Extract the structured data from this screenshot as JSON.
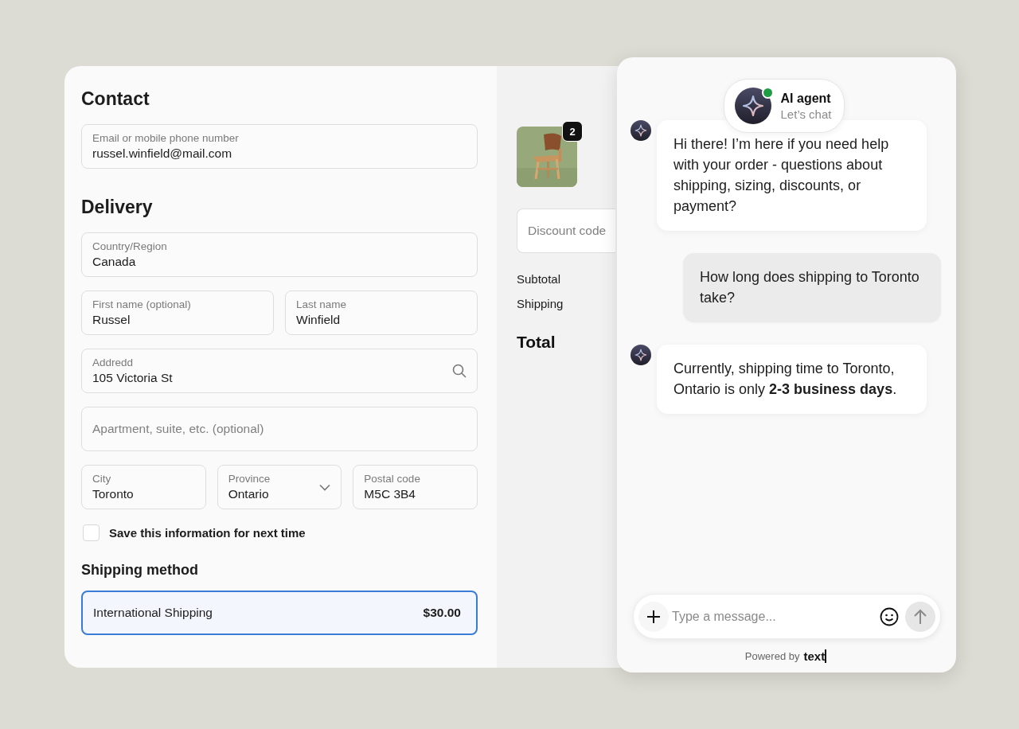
{
  "contact": {
    "heading": "Contact",
    "field": {
      "kind": "text",
      "label": "Email or mobile phone number",
      "value": "russel.winfield@mail.com"
    }
  },
  "delivery": {
    "heading": "Delivery",
    "rows": [
      [
        {
          "kind": "text",
          "label": "Country/Region",
          "value": "Canada"
        }
      ],
      [
        {
          "kind": "text",
          "label": "First name (optional)",
          "value": "Russel"
        },
        {
          "kind": "text",
          "label": "Last name",
          "value": "Winfield"
        }
      ],
      [
        {
          "kind": "search",
          "label": "Addredd",
          "value": "105 Victoria St"
        }
      ],
      [
        {
          "kind": "text",
          "placeholder": "Apartment, suite, etc. (optional)"
        }
      ],
      [
        {
          "kind": "text",
          "label": "City",
          "value": "Toronto"
        },
        {
          "kind": "select",
          "label": "Province",
          "value": "Ontario"
        },
        {
          "kind": "text",
          "label": "Postal code",
          "value": "M5C 3B4"
        }
      ]
    ],
    "save": {
      "label": "Save this information for next time",
      "checked": false
    }
  },
  "shipping_method": {
    "heading": "Shipping method",
    "options": [
      {
        "label": "International Shipping",
        "price": "$30.00",
        "selected": true
      }
    ]
  },
  "summary": {
    "item": {
      "kind": "picture",
      "quantity": "2"
    },
    "discount": {
      "placeholder": "Discount code"
    },
    "lines": [
      {
        "label": "Subtotal"
      },
      {
        "label": "Shipping"
      }
    ],
    "total": {
      "label": "Total"
    }
  },
  "chat": {
    "agent": {
      "name": "AI agent",
      "status": "Let’s chat",
      "online": true
    },
    "messages": [
      {
        "kind": "agent",
        "text": "Hi there! I’m here if you need help with your order - questions about shipping, sizing, discounts, or payment?"
      },
      {
        "kind": "user",
        "text": "How long does shipping to Toronto take?"
      },
      {
        "kind": "agent",
        "text": "Currently, shipping time to Toronto, Ontario is only **2-3 business days**."
      }
    ],
    "composer": {
      "placeholder": "Type a message..."
    },
    "footer": {
      "prefix": "Powered by",
      "brand": "text"
    }
  }
}
